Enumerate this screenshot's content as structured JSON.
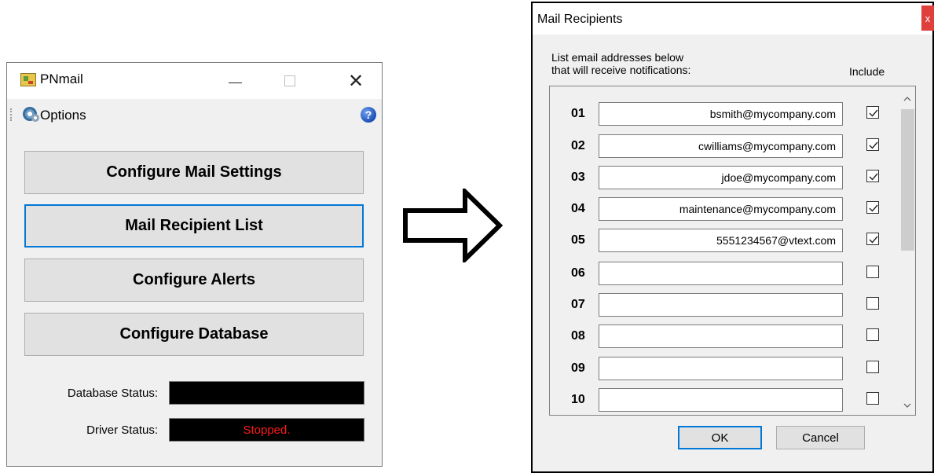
{
  "main_window": {
    "title": "PNmail",
    "menu": {
      "options_label": "Options"
    },
    "buttons": [
      {
        "label": "Configure Mail Settings"
      },
      {
        "label": "Mail Recipient List"
      },
      {
        "label": "Configure Alerts"
      },
      {
        "label": "Configure Database"
      }
    ],
    "database_status": {
      "label": "Database Status:",
      "value": ""
    },
    "driver_status": {
      "label": "Driver Status:",
      "value": "Stopped."
    }
  },
  "dialog": {
    "title": "Mail Recipients",
    "close_label": "x",
    "instructions_line1": "List email addresses below",
    "instructions_line2": "that will receive notifications:",
    "include_header": "Include",
    "recipients": [
      {
        "num": "01",
        "email": "bsmith@mycompany.com",
        "include": true
      },
      {
        "num": "02",
        "email": "cwilliams@mycompany.com",
        "include": true
      },
      {
        "num": "03",
        "email": "jdoe@mycompany.com",
        "include": true
      },
      {
        "num": "04",
        "email": "maintenance@mycompany.com",
        "include": true
      },
      {
        "num": "05",
        "email": "5551234567@vtext.com",
        "include": true
      },
      {
        "num": "06",
        "email": "",
        "include": false
      },
      {
        "num": "07",
        "email": "",
        "include": false
      },
      {
        "num": "08",
        "email": "",
        "include": false
      },
      {
        "num": "09",
        "email": "",
        "include": false
      },
      {
        "num": "10",
        "email": "",
        "include": false
      }
    ],
    "ok_label": "OK",
    "cancel_label": "Cancel"
  },
  "colors": {
    "focus_blue": "#0078d7",
    "status_text_red": "#ff1a1a",
    "close_red": "#e0403c"
  }
}
